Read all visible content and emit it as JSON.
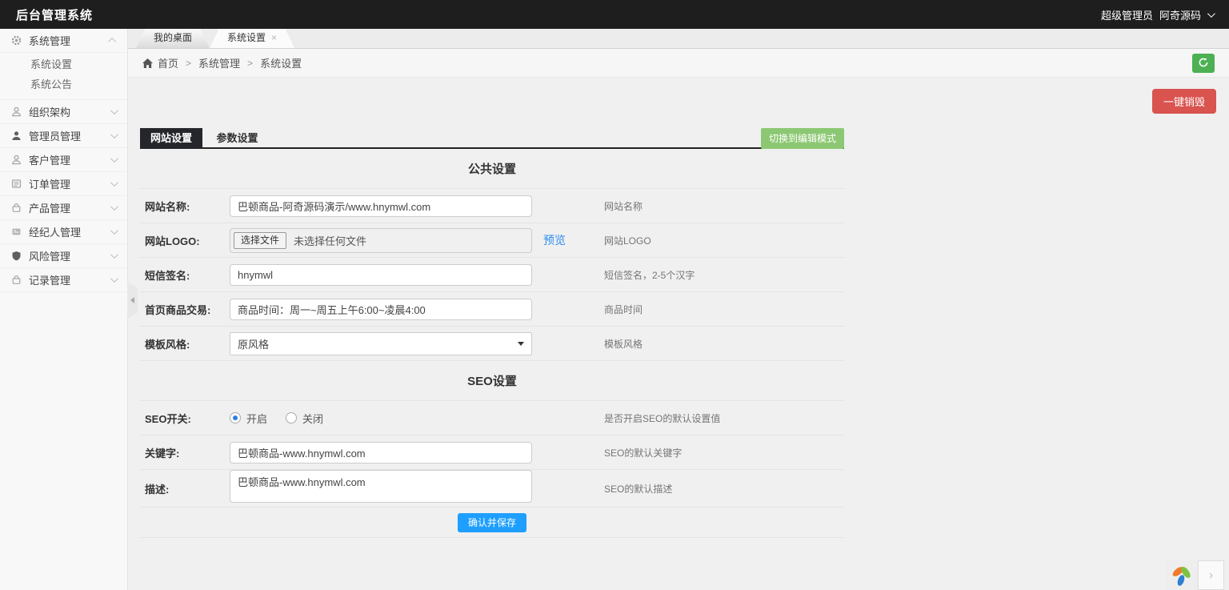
{
  "header": {
    "title": "后台管理系统",
    "user_role": "超级管理员",
    "user_name": "阿奇源码"
  },
  "sidebar": {
    "groups": [
      {
        "label": "系统管理",
        "icon": "gear-icon",
        "expanded": true
      },
      {
        "label": "组织架构",
        "icon": "org-icon"
      },
      {
        "label": "管理员管理",
        "icon": "admin-icon"
      },
      {
        "label": "客户管理",
        "icon": "customer-icon"
      },
      {
        "label": "订单管理",
        "icon": "order-icon"
      },
      {
        "label": "产品管理",
        "icon": "product-icon"
      },
      {
        "label": "经纪人管理",
        "icon": "broker-icon"
      },
      {
        "label": "风险管理",
        "icon": "risk-icon"
      },
      {
        "label": "记录管理",
        "icon": "record-icon"
      }
    ],
    "system_submenu": [
      "系统设置",
      "系统公告"
    ]
  },
  "window_tabs": {
    "desktop": "我的桌面",
    "settings": "系统设置",
    "close": "×"
  },
  "breadcrumb": {
    "home": "首页",
    "sep": ">",
    "level1": "系统管理",
    "level2": "系统设置"
  },
  "toolbar": {
    "destroy_label": "一键销毁",
    "edit_mode_label": "切换到编辑模式",
    "save_label": "确认并保存"
  },
  "form": {
    "tabs": {
      "site": "网站设置",
      "params": "参数设置"
    },
    "sections": {
      "common": "公共设置",
      "seo": "SEO设置"
    },
    "fields": {
      "site_name": {
        "label": "网站名称:",
        "value": "巴顿商品-阿奇源码演示/www.hnymwl.com",
        "hint": "网站名称"
      },
      "site_logo": {
        "label": "网站LOGO:",
        "button": "选择文件",
        "status": "未选择任何文件",
        "preview": "预览",
        "hint": "网站LOGO"
      },
      "sms_sign": {
        "label": "短信签名:",
        "value": "hnymwl",
        "hint": "短信签名，2-5个汉字"
      },
      "home_trade": {
        "label": "首页商品交易:",
        "value": "商品时间：周一~周五上午6:00~凌晨4:00",
        "hint": "商品时间"
      },
      "template_style": {
        "label": "模板风格:",
        "value": "原风格",
        "hint": "模板风格"
      },
      "seo_switch": {
        "label": "SEO开关:",
        "option_on": "开启",
        "option_off": "关闭",
        "selected": "开启",
        "hint": "是否开启SEO的默认设置值"
      },
      "keywords": {
        "label": "关键字:",
        "value": "巴顿商品-www.hnymwl.com",
        "hint": "SEO的默认关键字"
      },
      "description": {
        "label": "描述:",
        "value": "巴顿商品-www.hnymwl.com",
        "hint": "SEO的默认描述"
      }
    }
  },
  "colors": {
    "header_bg": "#1e1e1e",
    "edit_green": "#8cc873",
    "refresh_green": "#4db052",
    "danger_red": "#d9534f",
    "save_blue": "#1e9fff",
    "link_blue": "#2d8cf0"
  }
}
